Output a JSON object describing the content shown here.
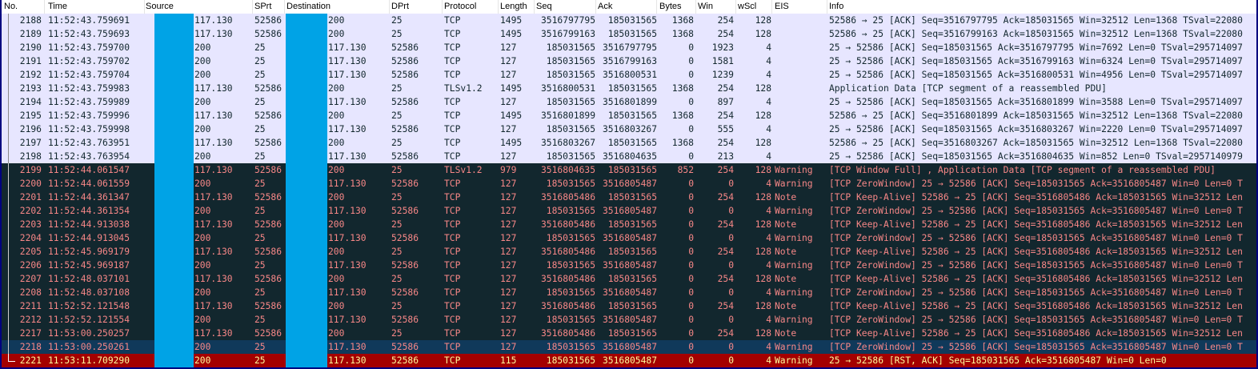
{
  "columns": [
    "No.",
    "Time",
    "Source",
    "SPrt",
    "Destination",
    "DPrt",
    "Protocol",
    "Length",
    "Seq",
    "Ack",
    "Bytes",
    "Win",
    "wScl",
    "EIS",
    "Info"
  ],
  "colors": {
    "light_row": "#e7e6ff",
    "dark_row": "#12272e",
    "dark_text": "#f78787",
    "selected_row": "#10395a",
    "error_row": "#a40000",
    "error_text": "#fffc9c",
    "redaction": "#00a3e6"
  },
  "rows": [
    {
      "style": "light",
      "no": "2188",
      "time": "11:52:43.759691",
      "src": "117.130",
      "sprt": "52586",
      "dst": "200",
      "dprt": "25",
      "proto": "TCP",
      "len": "1495",
      "seq": "3516797795",
      "ack": "185031565",
      "bytes": "1368",
      "win": "254",
      "wscl": "128",
      "eis": "",
      "info": "52586 → 25 [ACK] Seq=3516797795 Ack=185031565 Win=32512 Len=1368 TSval=22080"
    },
    {
      "style": "light",
      "no": "2189",
      "time": "11:52:43.759693",
      "src": "117.130",
      "sprt": "52586",
      "dst": "200",
      "dprt": "25",
      "proto": "TCP",
      "len": "1495",
      "seq": "3516799163",
      "ack": "185031565",
      "bytes": "1368",
      "win": "254",
      "wscl": "128",
      "eis": "",
      "info": "52586 → 25 [ACK] Seq=3516799163 Ack=185031565 Win=32512 Len=1368 TSval=22080"
    },
    {
      "style": "light",
      "no": "2190",
      "time": "11:52:43.759700",
      "src": "200",
      "sprt": "25",
      "dst": "117.130",
      "dprt": "52586",
      "proto": "TCP",
      "len": "127",
      "seq": "185031565",
      "ack": "3516797795",
      "bytes": "0",
      "win": "1923",
      "wscl": "4",
      "eis": "",
      "info": "25 → 52586 [ACK] Seq=185031565 Ack=3516797795 Win=7692 Len=0 TSval=295714097"
    },
    {
      "style": "light",
      "no": "2191",
      "time": "11:52:43.759702",
      "src": "200",
      "sprt": "25",
      "dst": "117.130",
      "dprt": "52586",
      "proto": "TCP",
      "len": "127",
      "seq": "185031565",
      "ack": "3516799163",
      "bytes": "0",
      "win": "1581",
      "wscl": "4",
      "eis": "",
      "info": "25 → 52586 [ACK] Seq=185031565 Ack=3516799163 Win=6324 Len=0 TSval=295714097"
    },
    {
      "style": "light",
      "no": "2192",
      "time": "11:52:43.759704",
      "src": "200",
      "sprt": "25",
      "dst": "117.130",
      "dprt": "52586",
      "proto": "TCP",
      "len": "127",
      "seq": "185031565",
      "ack": "3516800531",
      "bytes": "0",
      "win": "1239",
      "wscl": "4",
      "eis": "",
      "info": "25 → 52586 [ACK] Seq=185031565 Ack=3516800531 Win=4956 Len=0 TSval=295714097"
    },
    {
      "style": "light",
      "no": "2193",
      "time": "11:52:43.759983",
      "src": "117.130",
      "sprt": "52586",
      "dst": "200",
      "dprt": "25",
      "proto": "TLSv1.2",
      "len": "1495",
      "seq": "3516800531",
      "ack": "185031565",
      "bytes": "1368",
      "win": "254",
      "wscl": "128",
      "eis": "",
      "info": "Application Data [TCP segment of a reassembled PDU]"
    },
    {
      "style": "light",
      "no": "2194",
      "time": "11:52:43.759989",
      "src": "200",
      "sprt": "25",
      "dst": "117.130",
      "dprt": "52586",
      "proto": "TCP",
      "len": "127",
      "seq": "185031565",
      "ack": "3516801899",
      "bytes": "0",
      "win": "897",
      "wscl": "4",
      "eis": "",
      "info": "25 → 52586 [ACK] Seq=185031565 Ack=3516801899 Win=3588 Len=0 TSval=295714097"
    },
    {
      "style": "light",
      "no": "2195",
      "time": "11:52:43.759996",
      "src": "117.130",
      "sprt": "52586",
      "dst": "200",
      "dprt": "25",
      "proto": "TCP",
      "len": "1495",
      "seq": "3516801899",
      "ack": "185031565",
      "bytes": "1368",
      "win": "254",
      "wscl": "128",
      "eis": "",
      "info": "52586 → 25 [ACK] Seq=3516801899 Ack=185031565 Win=32512 Len=1368 TSval=22080"
    },
    {
      "style": "light",
      "no": "2196",
      "time": "11:52:43.759998",
      "src": "200",
      "sprt": "25",
      "dst": "117.130",
      "dprt": "52586",
      "proto": "TCP",
      "len": "127",
      "seq": "185031565",
      "ack": "3516803267",
      "bytes": "0",
      "win": "555",
      "wscl": "4",
      "eis": "",
      "info": "25 → 52586 [ACK] Seq=185031565 Ack=3516803267 Win=2220 Len=0 TSval=295714097"
    },
    {
      "style": "light",
      "no": "2197",
      "time": "11:52:43.763951",
      "src": "117.130",
      "sprt": "52586",
      "dst": "200",
      "dprt": "25",
      "proto": "TCP",
      "len": "1495",
      "seq": "3516803267",
      "ack": "185031565",
      "bytes": "1368",
      "win": "254",
      "wscl": "128",
      "eis": "",
      "info": "52586 → 25 [ACK] Seq=3516803267 Ack=185031565 Win=32512 Len=1368 TSval=22080"
    },
    {
      "style": "light",
      "no": "2198",
      "time": "11:52:43.763954",
      "src": "200",
      "sprt": "25",
      "dst": "117.130",
      "dprt": "52586",
      "proto": "TCP",
      "len": "127",
      "seq": "185031565",
      "ack": "3516804635",
      "bytes": "0",
      "win": "213",
      "wscl": "4",
      "eis": "",
      "info": "25 → 52586 [ACK] Seq=185031565 Ack=3516804635 Win=852 Len=0 TSval=2957140979"
    },
    {
      "style": "dark",
      "no": "2199",
      "time": "11:52:44.061547",
      "src": "117.130",
      "sprt": "52586",
      "dst": "200",
      "dprt": "25",
      "proto": "TLSv1.2",
      "len": "979",
      "seq": "3516804635",
      "ack": "185031565",
      "bytes": "852",
      "win": "254",
      "wscl": "128",
      "eis": "Warning",
      "info": "[TCP Window Full] , Application Data [TCP segment of a reassembled PDU]"
    },
    {
      "style": "dark",
      "no": "2200",
      "time": "11:52:44.061559",
      "src": "200",
      "sprt": "25",
      "dst": "117.130",
      "dprt": "52586",
      "proto": "TCP",
      "len": "127",
      "seq": "185031565",
      "ack": "3516805487",
      "bytes": "0",
      "win": "0",
      "wscl": "4",
      "eis": "Warning",
      "info": "[TCP ZeroWindow] 25 → 52586 [ACK] Seq=185031565 Ack=3516805487 Win=0 Len=0 T"
    },
    {
      "style": "dark",
      "no": "2201",
      "time": "11:52:44.361347",
      "src": "117.130",
      "sprt": "52586",
      "dst": "200",
      "dprt": "25",
      "proto": "TCP",
      "len": "127",
      "seq": "3516805486",
      "ack": "185031565",
      "bytes": "0",
      "win": "254",
      "wscl": "128",
      "eis": "Note",
      "info": "[TCP Keep-Alive] 52586 → 25 [ACK] Seq=3516805486 Ack=185031565 Win=32512 Len"
    },
    {
      "style": "dark",
      "no": "2202",
      "time": "11:52:44.361354",
      "src": "200",
      "sprt": "25",
      "dst": "117.130",
      "dprt": "52586",
      "proto": "TCP",
      "len": "127",
      "seq": "185031565",
      "ack": "3516805487",
      "bytes": "0",
      "win": "0",
      "wscl": "4",
      "eis": "Warning",
      "info": "[TCP ZeroWindow] 25 → 52586 [ACK] Seq=185031565 Ack=3516805487 Win=0 Len=0 T"
    },
    {
      "style": "dark",
      "no": "2203",
      "time": "11:52:44.913038",
      "src": "117.130",
      "sprt": "52586",
      "dst": "200",
      "dprt": "25",
      "proto": "TCP",
      "len": "127",
      "seq": "3516805486",
      "ack": "185031565",
      "bytes": "0",
      "win": "254",
      "wscl": "128",
      "eis": "Note",
      "info": "[TCP Keep-Alive] 52586 → 25 [ACK] Seq=3516805486 Ack=185031565 Win=32512 Len"
    },
    {
      "style": "dark",
      "no": "2204",
      "time": "11:52:44.913045",
      "src": "200",
      "sprt": "25",
      "dst": "117.130",
      "dprt": "52586",
      "proto": "TCP",
      "len": "127",
      "seq": "185031565",
      "ack": "3516805487",
      "bytes": "0",
      "win": "0",
      "wscl": "4",
      "eis": "Warning",
      "info": "[TCP ZeroWindow] 25 → 52586 [ACK] Seq=185031565 Ack=3516805487 Win=0 Len=0 T"
    },
    {
      "style": "dark",
      "no": "2205",
      "time": "11:52:45.969179",
      "src": "117.130",
      "sprt": "52586",
      "dst": "200",
      "dprt": "25",
      "proto": "TCP",
      "len": "127",
      "seq": "3516805486",
      "ack": "185031565",
      "bytes": "0",
      "win": "254",
      "wscl": "128",
      "eis": "Note",
      "info": "[TCP Keep-Alive] 52586 → 25 [ACK] Seq=3516805486 Ack=185031565 Win=32512 Len"
    },
    {
      "style": "dark",
      "no": "2206",
      "time": "11:52:45.969187",
      "src": "200",
      "sprt": "25",
      "dst": "117.130",
      "dprt": "52586",
      "proto": "TCP",
      "len": "127",
      "seq": "185031565",
      "ack": "3516805487",
      "bytes": "0",
      "win": "0",
      "wscl": "4",
      "eis": "Warning",
      "info": "[TCP ZeroWindow] 25 → 52586 [ACK] Seq=185031565 Ack=3516805487 Win=0 Len=0 T"
    },
    {
      "style": "dark",
      "no": "2207",
      "time": "11:52:48.037101",
      "src": "117.130",
      "sprt": "52586",
      "dst": "200",
      "dprt": "25",
      "proto": "TCP",
      "len": "127",
      "seq": "3516805486",
      "ack": "185031565",
      "bytes": "0",
      "win": "254",
      "wscl": "128",
      "eis": "Note",
      "info": "[TCP Keep-Alive] 52586 → 25 [ACK] Seq=3516805486 Ack=185031565 Win=32512 Len"
    },
    {
      "style": "dark",
      "no": "2208",
      "time": "11:52:48.037108",
      "src": "200",
      "sprt": "25",
      "dst": "117.130",
      "dprt": "52586",
      "proto": "TCP",
      "len": "127",
      "seq": "185031565",
      "ack": "3516805487",
      "bytes": "0",
      "win": "0",
      "wscl": "4",
      "eis": "Warning",
      "info": "[TCP ZeroWindow] 25 → 52586 [ACK] Seq=185031565 Ack=3516805487 Win=0 Len=0 T"
    },
    {
      "style": "dark",
      "no": "2211",
      "time": "11:52:52.121548",
      "src": "117.130",
      "sprt": "52586",
      "dst": "200",
      "dprt": "25",
      "proto": "TCP",
      "len": "127",
      "seq": "3516805486",
      "ack": "185031565",
      "bytes": "0",
      "win": "254",
      "wscl": "128",
      "eis": "Note",
      "info": "[TCP Keep-Alive] 52586 → 25 [ACK] Seq=3516805486 Ack=185031565 Win=32512 Len"
    },
    {
      "style": "dark",
      "no": "2212",
      "time": "11:52:52.121554",
      "src": "200",
      "sprt": "25",
      "dst": "117.130",
      "dprt": "52586",
      "proto": "TCP",
      "len": "127",
      "seq": "185031565",
      "ack": "3516805487",
      "bytes": "0",
      "win": "0",
      "wscl": "4",
      "eis": "Warning",
      "info": "[TCP ZeroWindow] 25 → 52586 [ACK] Seq=185031565 Ack=3516805487 Win=0 Len=0 T"
    },
    {
      "style": "dark",
      "no": "2217",
      "time": "11:53:00.250257",
      "src": "117.130",
      "sprt": "52586",
      "dst": "200",
      "dprt": "25",
      "proto": "TCP",
      "len": "127",
      "seq": "3516805486",
      "ack": "185031565",
      "bytes": "0",
      "win": "254",
      "wscl": "128",
      "eis": "Note",
      "info": "[TCP Keep-Alive] 52586 → 25 [ACK] Seq=3516805486 Ack=185031565 Win=32512 Len"
    },
    {
      "style": "sel",
      "no": "2218",
      "time": "11:53:00.250261",
      "src": "200",
      "sprt": "25",
      "dst": "117.130",
      "dprt": "52586",
      "proto": "TCP",
      "len": "127",
      "seq": "185031565",
      "ack": "3516805487",
      "bytes": "0",
      "win": "0",
      "wscl": "4",
      "eis": "Warning",
      "info": "[TCP ZeroWindow] 25 → 52586 [ACK] Seq=185031565 Ack=3516805487 Win=0 Len=0 T"
    },
    {
      "style": "err",
      "no": "2221",
      "time": "11:53:11.709290",
      "src": "200",
      "sprt": "25",
      "dst": "117.130",
      "dprt": "52586",
      "proto": "TCP",
      "len": "115",
      "seq": "185031565",
      "ack": "3516805487",
      "bytes": "0",
      "win": "0",
      "wscl": "4",
      "eis": "Warning",
      "info": "25 → 52586 [RST, ACK] Seq=185031565 Ack=3516805487 Win=0 Len=0"
    }
  ]
}
